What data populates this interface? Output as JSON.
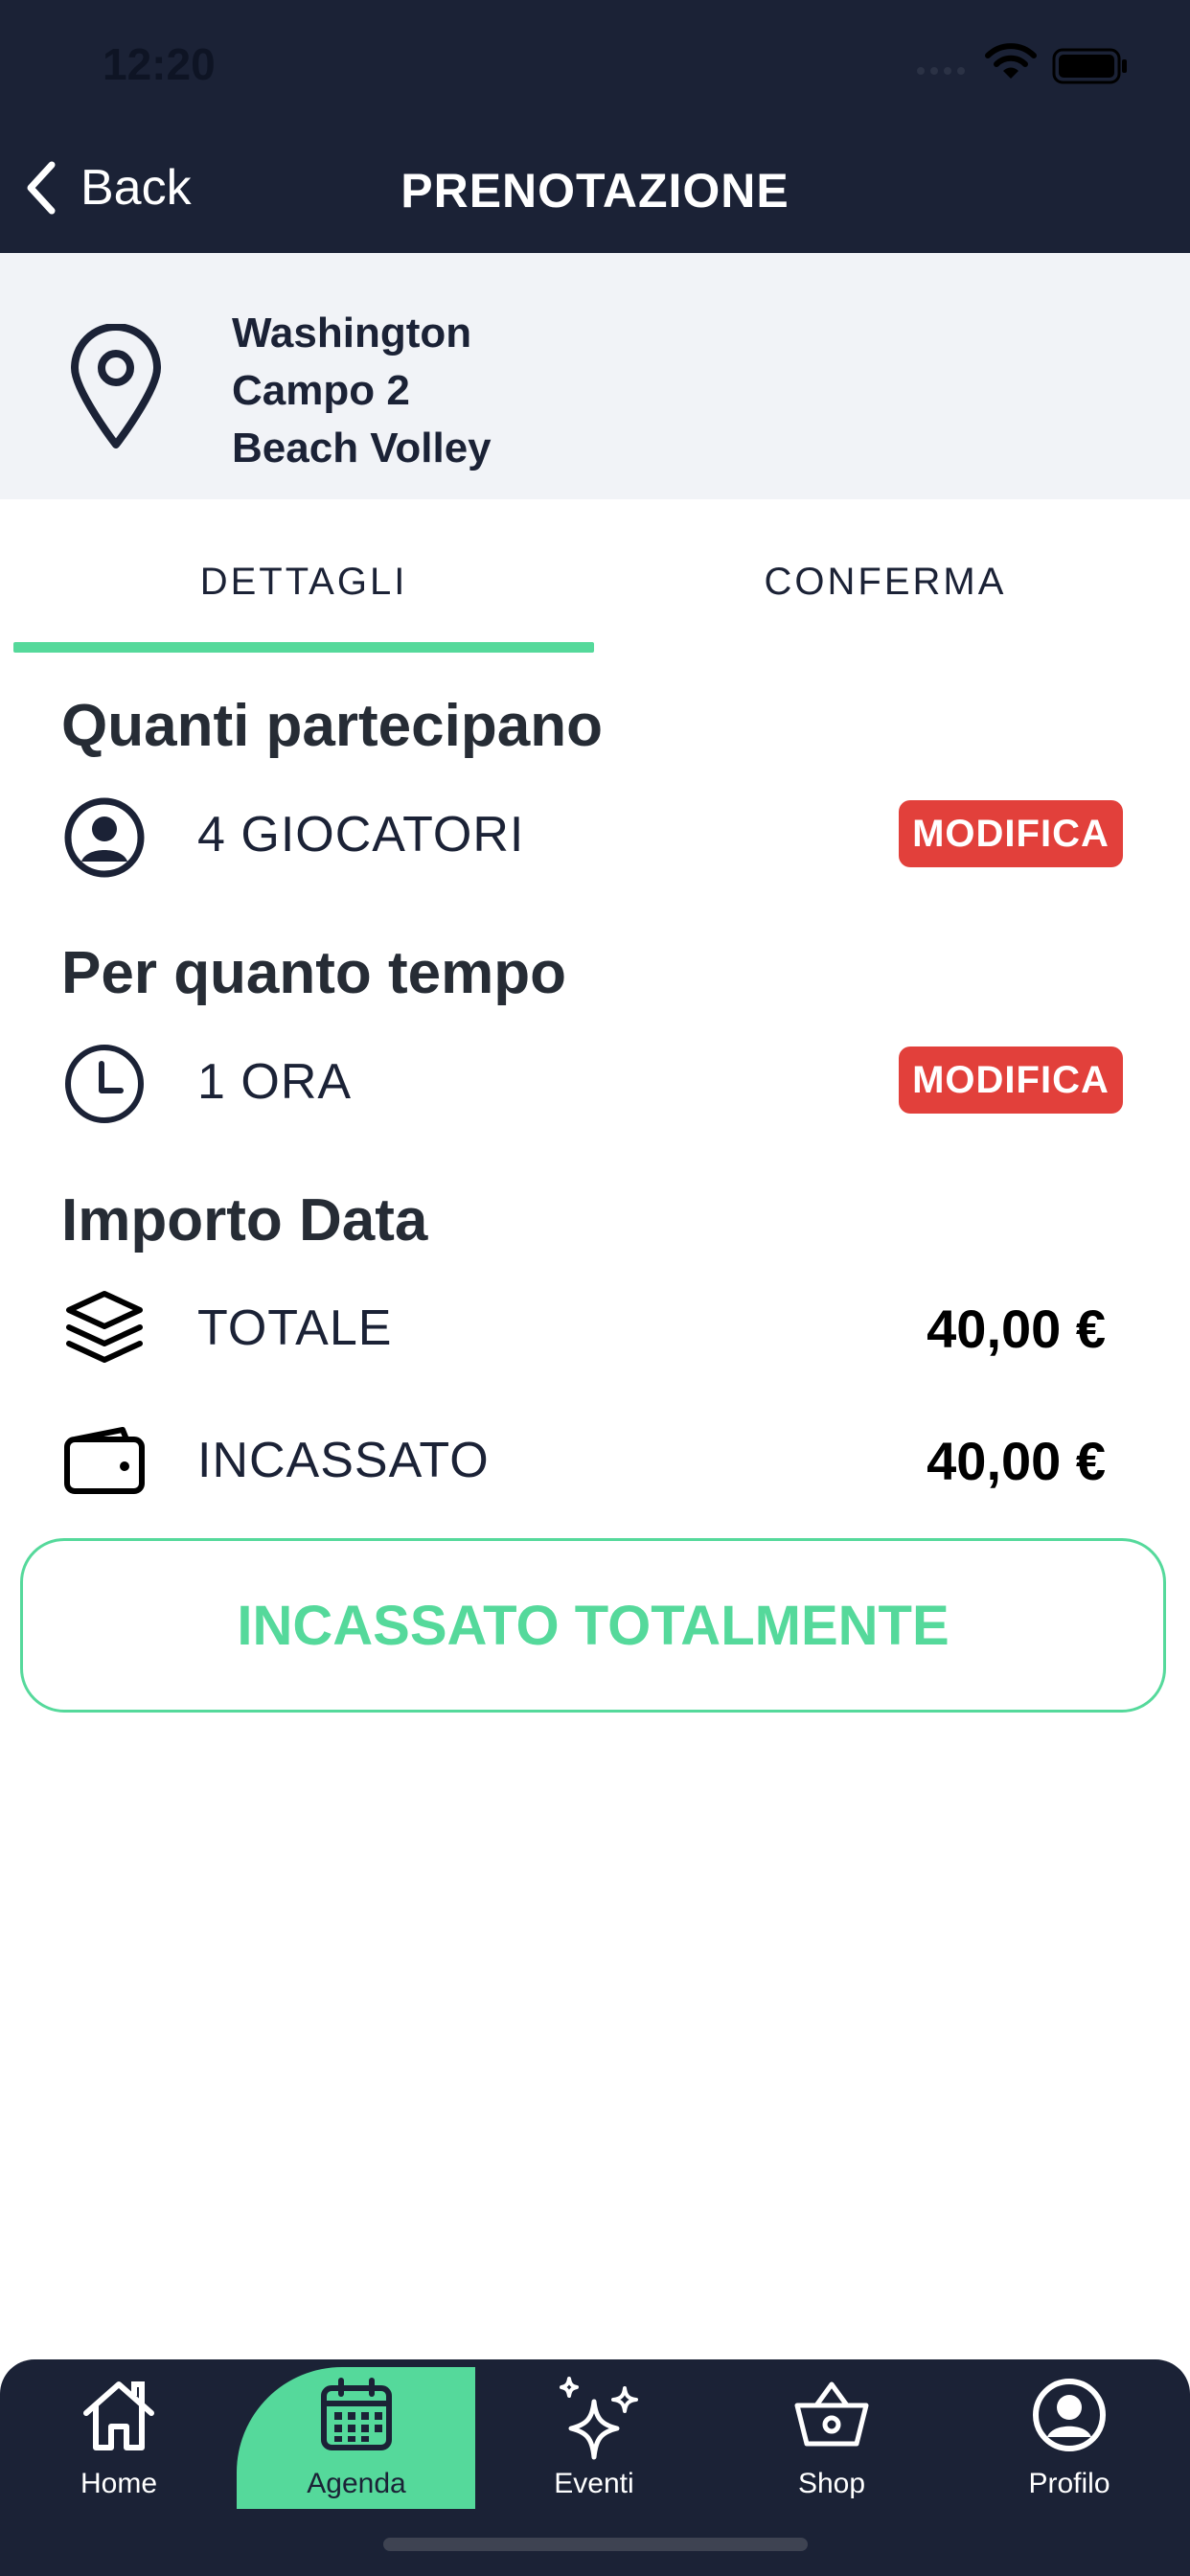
{
  "status_bar": {
    "time": "12:20"
  },
  "nav": {
    "back_label": "Back",
    "title": "PRENOTAZIONE"
  },
  "location": {
    "lines": [
      "Washington",
      "Campo 2",
      "Beach Volley"
    ]
  },
  "tabs": [
    {
      "label": "DETTAGLI",
      "active": true
    },
    {
      "label": "CONFERMA",
      "active": false
    }
  ],
  "participants": {
    "title": "Quanti partecipano",
    "value": "4 GIOCATORI",
    "edit_label": "MODIFICA"
  },
  "duration": {
    "title": "Per quanto tempo",
    "value": "1 ORA",
    "edit_label": "MODIFICA"
  },
  "amount": {
    "title": "Importo Data",
    "total_label": "TOTALE",
    "total_value": "40,00 €",
    "collected_label": "INCASSATO",
    "collected_value": "40,00 €"
  },
  "status_button": {
    "label": "INCASSATO TOTALMENTE"
  },
  "tabbar": {
    "items": [
      {
        "label": "Home",
        "icon": "home-icon"
      },
      {
        "label": "Agenda",
        "icon": "calendar-icon",
        "active": true
      },
      {
        "label": "Eventi",
        "icon": "sparkles-icon"
      },
      {
        "label": "Shop",
        "icon": "basket-icon"
      },
      {
        "label": "Profilo",
        "icon": "profile-icon"
      }
    ]
  },
  "colors": {
    "navy": "#1b2236",
    "accent_green": "#55d99b",
    "danger_red": "#e2403b"
  }
}
